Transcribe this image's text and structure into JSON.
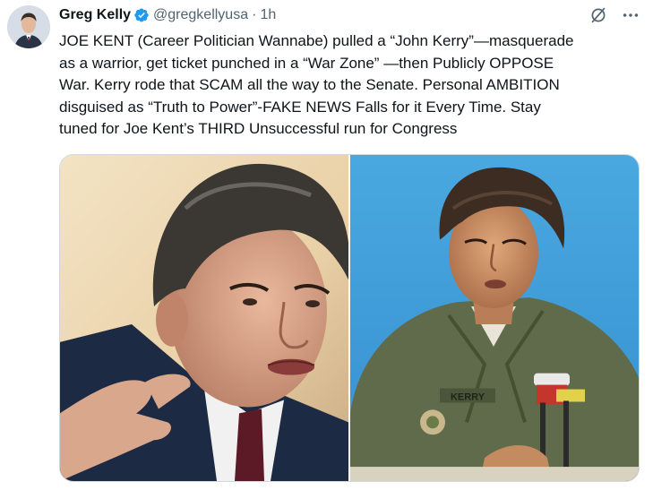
{
  "tweet": {
    "author": {
      "display_name": "Greg Kelly",
      "handle": "@gregkellyusa",
      "separator": "·",
      "time": "1h",
      "verified_color": "#1d9bf0"
    },
    "text": "JOE KENT (Career Politician Wannabe) pulled a “John Kerry”—masquerade\nas a warrior, get ticket punched in a “War Zone” —then Publicly OPPOSE\nWar. Kerry rode that SCAM all the way to the Senate.  Personal AMBITION\ndisguised as “Truth to Power”-FAKE NEWS Falls for it Every Time. Stay\ntuned for Joe Kent’s THIRD Unsuccessful run for Congress",
    "icons": {
      "grok": "grok-icon",
      "more": "more-options-icon",
      "verified": "verified-badge-icon"
    },
    "media": {
      "left_photo_label": "photo-man-in-suit-speaking",
      "right_photo_label": "photo-man-in-army-jacket-at-microphone",
      "uniform_tape_text": "KERRY"
    }
  }
}
